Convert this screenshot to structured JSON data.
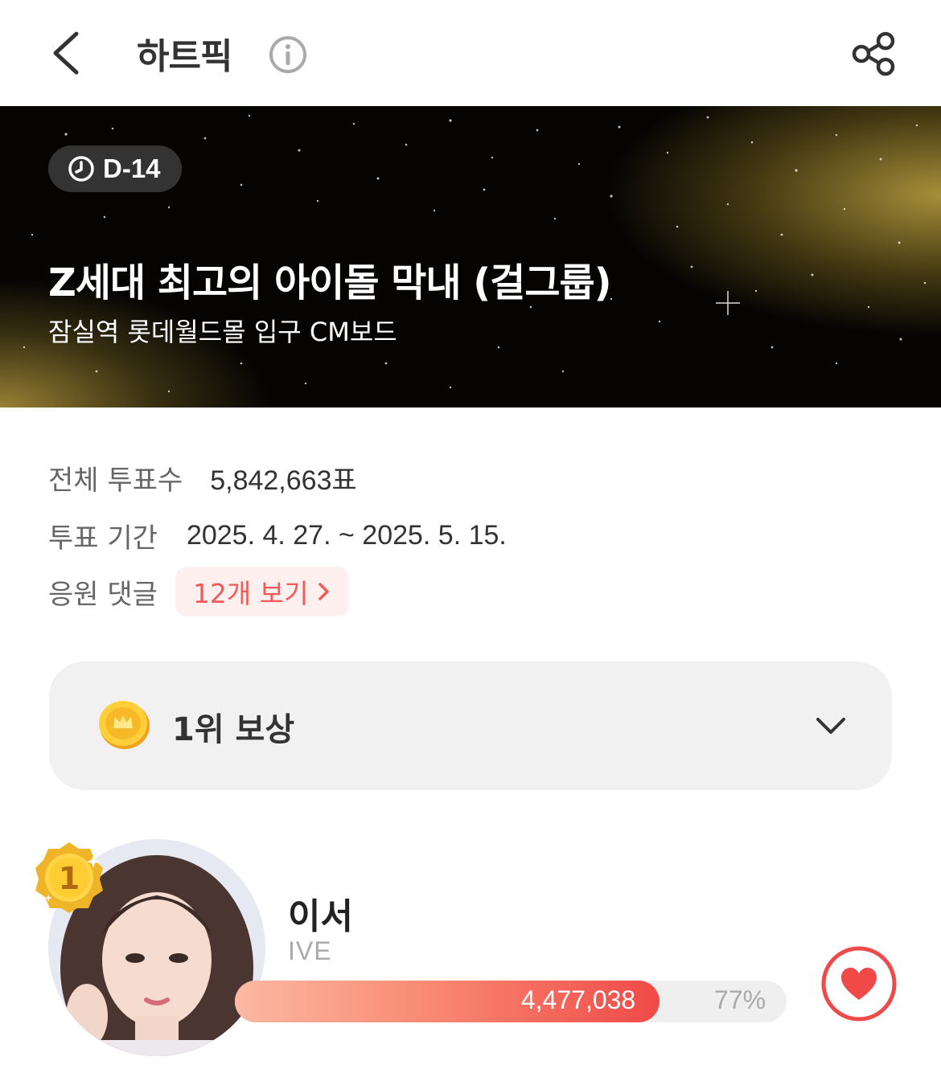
{
  "header": {
    "title": "하트픽",
    "back_icon": "chevron-left-icon",
    "info_icon": "info-icon",
    "share_icon": "share-icon"
  },
  "banner": {
    "dday": "D-14",
    "title": "Z세대 최고의 아이돌 막내 (걸그룹)",
    "subtitle": "잠실역 롯데월드몰 입구 CM보드",
    "accent_color": "#a8913a"
  },
  "info": {
    "total_votes_label": "전체 투표수",
    "total_votes_value": "5,842,663표",
    "period_label": "투표 기간",
    "period_value": "2025. 4. 27. ~ 2025. 5. 15.",
    "comments_label": "응원 댓글",
    "comments_button": "12개 보기"
  },
  "reward": {
    "label": "1위 보상"
  },
  "candidates": [
    {
      "rank": "1",
      "name": "이서",
      "group": "IVE",
      "votes": "4,477,038",
      "percent": "77%",
      "share": 0.77
    }
  ],
  "colors": {
    "accent": "#f04a48",
    "comment_bg": "#fff0f0",
    "comment_text": "#f25a5a"
  }
}
